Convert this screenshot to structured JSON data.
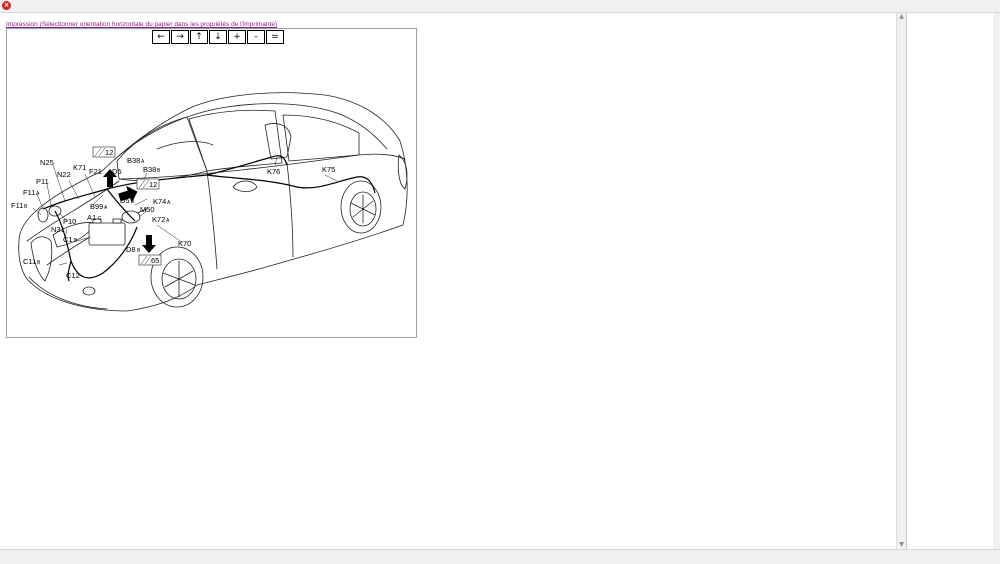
{
  "window": {
    "close_glyph": "×",
    "scroll_up": "▲",
    "scroll_down": "▼"
  },
  "print_link": "Impression (Sélectionner orientation horizontale du papier dans les propriétés de l'imprimante)",
  "nav": {
    "left": "←",
    "right": "→",
    "up": "↑",
    "down": "↓",
    "zoom_in": "+",
    "zoom_out": "-",
    "reset": "="
  },
  "diagram": {
    "labels": {
      "n25": "N25",
      "k71": "K71",
      "n22": "N22",
      "f21": "F21",
      "d5_top": "D5",
      "ref12_top": "12",
      "b38a": "B38",
      "b38a_sub": "A",
      "b38b": "B38",
      "b38b_sub": "B",
      "ref12_mid": "12",
      "p11": "P11",
      "f11a": "F11",
      "f11a_sub": "A",
      "f11b": "F11",
      "f11b_sub": "B",
      "p10": "P10",
      "b99a": "B99",
      "b99a_sub": "A",
      "d5b": "D5",
      "d5b_sub": "B",
      "k74": "K74",
      "k74_sub": "A",
      "m50": "M50",
      "a1c": "A1",
      "a1c_sub": "C",
      "k72": "K72",
      "k72_sub": "A",
      "n31": "N31",
      "c1b": "C1",
      "c1b_sub": "B",
      "k70": "K70",
      "d8b": "D8",
      "d8b_sub": "B",
      "ref65": "65",
      "c11b": "C11",
      "c11b_sub": "B",
      "c12": "C12",
      "k76": "K76",
      "k75": "K75"
    }
  }
}
